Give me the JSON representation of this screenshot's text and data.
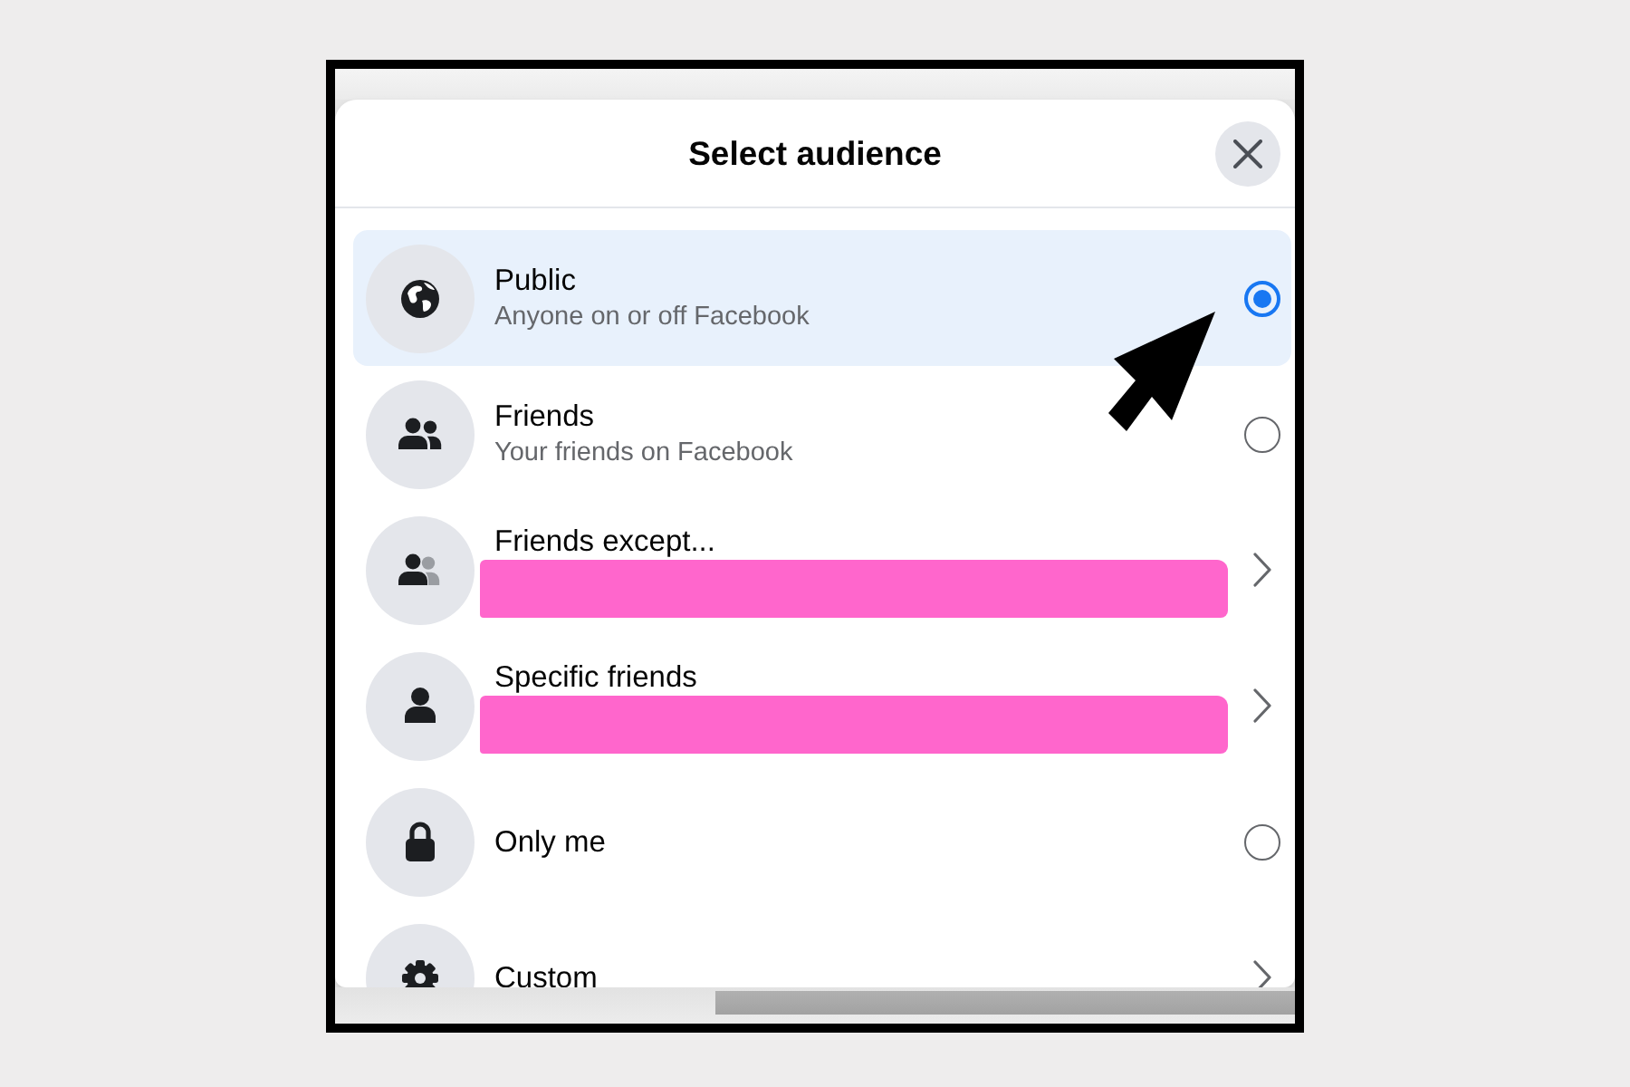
{
  "dialog": {
    "title": "Select audience"
  },
  "options": [
    {
      "title": "Public",
      "subtitle": "Anyone on or off Facebook",
      "kind": "radio",
      "selected": true,
      "redacted": false
    },
    {
      "title": "Friends",
      "subtitle": "Your friends on Facebook",
      "kind": "radio",
      "selected": false,
      "redacted": false
    },
    {
      "title": "Friends except...",
      "kind": "submenu",
      "selected": false,
      "redacted": true
    },
    {
      "title": "Specific friends",
      "kind": "submenu",
      "selected": false,
      "redacted": true
    },
    {
      "title": "Only me",
      "kind": "radio",
      "selected": false,
      "redacted": false
    },
    {
      "title": "Custom",
      "kind": "submenu",
      "selected": false,
      "redacted": false
    }
  ]
}
